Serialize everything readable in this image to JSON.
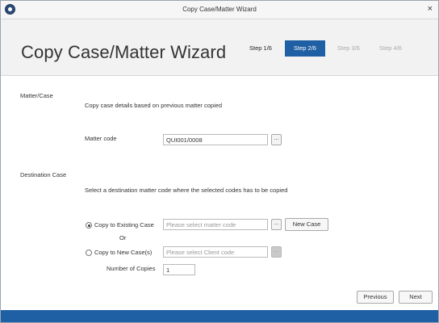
{
  "window": {
    "title": "Copy Case/Matter Wizard",
    "close_glyph": "×"
  },
  "header": {
    "title": "Copy Case/Matter Wizard",
    "steps": [
      {
        "label": "Step 1/6",
        "state": "done"
      },
      {
        "label": "Step 2/6",
        "state": "active"
      },
      {
        "label": "Step 3/6",
        "state": "future"
      },
      {
        "label": "Step 4/6",
        "state": "future"
      }
    ]
  },
  "matter_case": {
    "heading": "Matter/Case",
    "description": "Copy case details based on previous matter copied",
    "matter_code_label": "Matter code",
    "matter_code_value": "QUI001/0008",
    "browse_label": "..."
  },
  "destination": {
    "heading": "Destination Case",
    "description": "Select a destination matter code where the selected codes has to be copied",
    "existing_label": "Copy to Existing Case",
    "existing_placeholder": "Please select matter code",
    "existing_browse_label": "...",
    "new_case_button": "New Case",
    "or_label": "Or",
    "new_label": "Copy to New Case(s)",
    "new_placeholder": "Please select Client code",
    "new_browse_label": "...",
    "copies_label": "Number of Copies",
    "copies_value": "1",
    "selected_option": "existing"
  },
  "footer": {
    "previous_label": "Previous",
    "next_label": "Next"
  },
  "colors": {
    "accent": "#1f5fa3",
    "header_bg": "#f2f2f2"
  },
  "icons": {
    "app": "app-logo-icon",
    "close": "close-icon"
  }
}
